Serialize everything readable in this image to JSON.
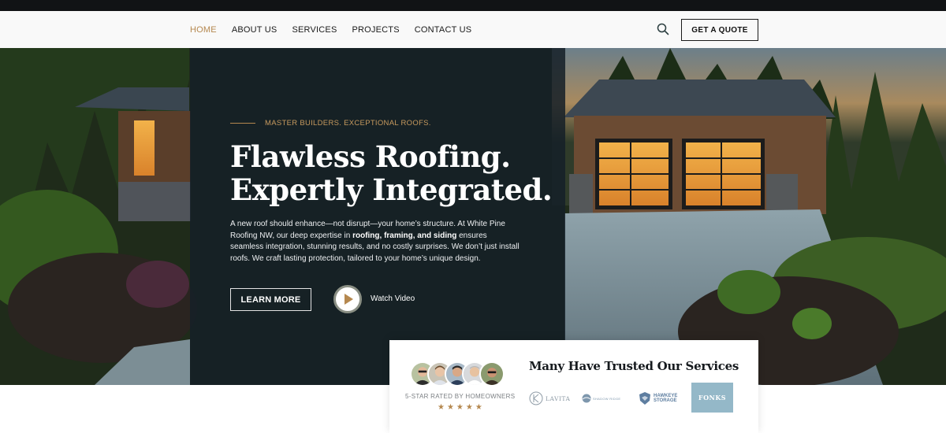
{
  "nav": {
    "items": [
      {
        "label": "HOME",
        "active": true
      },
      {
        "label": "ABOUT US",
        "active": false
      },
      {
        "label": "SERVICES",
        "active": false
      },
      {
        "label": "PROJECTS",
        "active": false
      },
      {
        "label": "CONTACT US",
        "active": false
      }
    ],
    "search_icon": "search-icon",
    "quote_button": "GET A QUOTE"
  },
  "hero": {
    "eyebrow": "MASTER BUILDERS. EXCEPTIONAL ROOFS.",
    "title_line1": "Flawless Roofing.",
    "title_line2": "Expertly Integrated.",
    "desc_part1": "A new roof should enhance—not disrupt—your home’s structure. At White Pine Roofing NW, our deep expertise in ",
    "desc_bold": "roofing, framing, and siding",
    "desc_part2": " ensures seamless integration, stunning results, and no costly surprises. We don’t just install roofs. We craft lasting protection, tailored to your home’s unique design.",
    "learn_more": "LEARN MORE",
    "watch_video": "Watch Video",
    "play_icon": "play-icon"
  },
  "trust": {
    "title": "Many Have Trusted Our Services",
    "rated": "5-STAR RATED BY HOMEOWNERS",
    "stars": "★★★★★",
    "rating": 5,
    "logos": {
      "lavita": "LAVITA",
      "shadow": "SHADOW RIDGE",
      "hawkeye_line1": "HAWKEYE",
      "hawkeye_line2": "STORAGE",
      "fonks": "FONKS"
    }
  },
  "colors": {
    "accent": "#b5884f",
    "panel": "#152028",
    "topbar": "#111315"
  }
}
